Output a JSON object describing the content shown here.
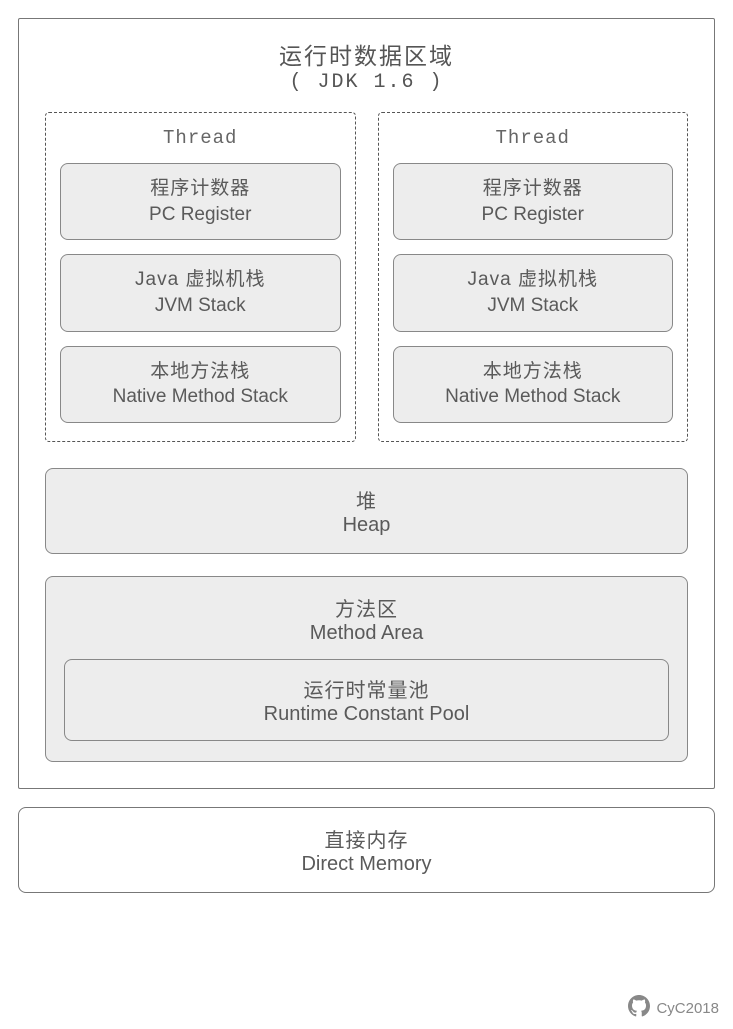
{
  "runtime": {
    "title_cn": "运行时数据区域",
    "title_en": "( JDK 1.6 )"
  },
  "threads": [
    {
      "title": "Thread",
      "components": [
        {
          "cn": "程序计数器",
          "en": "PC Register"
        },
        {
          "cn": "Java 虚拟机栈",
          "en": "JVM Stack"
        },
        {
          "cn": "本地方法栈",
          "en": "Native Method Stack"
        }
      ]
    },
    {
      "title": "Thread",
      "components": [
        {
          "cn": "程序计数器",
          "en": "PC Register"
        },
        {
          "cn": "Java 虚拟机栈",
          "en": "JVM Stack"
        },
        {
          "cn": "本地方法栈",
          "en": "Native Method Stack"
        }
      ]
    }
  ],
  "heap": {
    "cn": "堆",
    "en": "Heap"
  },
  "method_area": {
    "cn": "方法区",
    "en": "Method Area",
    "constant_pool": {
      "cn": "运行时常量池",
      "en": "Runtime Constant Pool"
    }
  },
  "direct_memory": {
    "cn": "直接内存",
    "en": "Direct Memory"
  },
  "watermark": "CyC2018"
}
